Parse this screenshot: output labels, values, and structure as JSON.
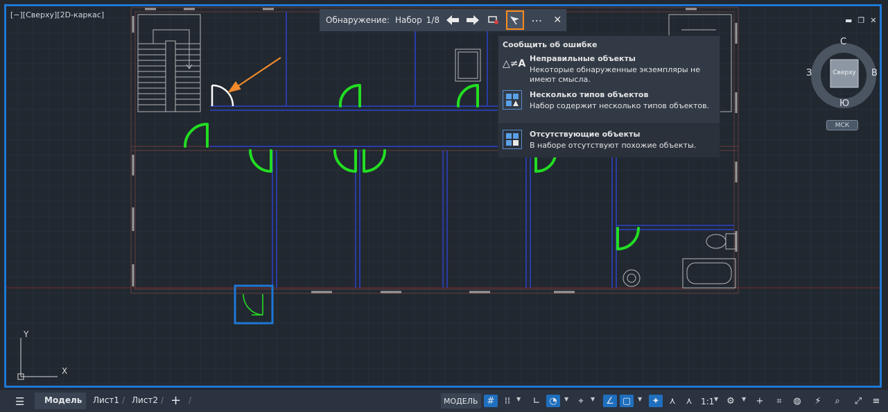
{
  "viewport": {
    "label": "[−][Сверху][2D-каркас]",
    "colors": {
      "border": "#1e78d6",
      "door": "#22dd22",
      "wall": "#2a3ca6",
      "arrow": "#f08a2c",
      "highlight": "#1e78d6"
    }
  },
  "detect_toolbar": {
    "label": "Обнаружение:",
    "set_label": "Набор",
    "counter": "1/8",
    "prev_icon": "arrow-left-icon",
    "next_icon": "arrow-right-icon",
    "zoom_icon": "zoom-selection-icon",
    "flag_icon": "flag-icon",
    "more_icon": "more-icon",
    "close_icon": "close-icon"
  },
  "report_menu": {
    "title": "Сообщить об ошибке",
    "items": [
      {
        "icon": "not-equal-icon",
        "title": "Неправильные объекты",
        "desc": "Некоторые обнаруженные экземпляры не имеют смысла."
      },
      {
        "icon": "multiple-types-icon",
        "title": "Несколько типов объектов",
        "desc": "Набор содержит несколько типов объектов."
      },
      {
        "icon": "missing-objects-icon",
        "title": "Отсутствующие объекты",
        "desc": "В наборе отсутствуют похожие объекты."
      }
    ]
  },
  "navcube": {
    "top_face": "Сверху",
    "north": "С",
    "south": "Ю",
    "west": "З",
    "east": "В",
    "wcs": "МСК"
  },
  "ucs": {
    "x": "X",
    "y": "Y"
  },
  "statusbar": {
    "tabs": [
      "Модель",
      "Лист1",
      "Лист2"
    ],
    "active_tab": "Модель",
    "mode": "МОДЕЛЬ",
    "scale": "1:1"
  }
}
